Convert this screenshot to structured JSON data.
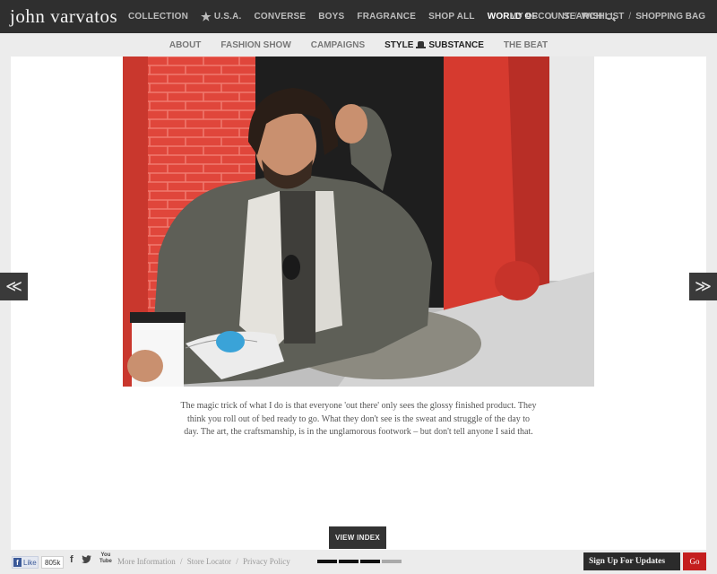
{
  "header": {
    "brand": "john varvatos",
    "nav": [
      {
        "label": "COLLECTION"
      },
      {
        "label": "U.S.A.",
        "icon": "star-icon"
      },
      {
        "label": "CONVERSE"
      },
      {
        "label": "BOYS"
      },
      {
        "label": "FRAGRANCE"
      },
      {
        "label": "SHOP ALL"
      },
      {
        "label": "WORLD OF",
        "active": true
      }
    ],
    "nav_separator": "/",
    "search_label": "SEARCH",
    "account": {
      "my_account": "MY ACCOUNT",
      "wishlist": "WISHLIST",
      "shopping_bag": "SHOPPING BAG",
      "separator": "/"
    }
  },
  "subnav": {
    "items": [
      "ABOUT",
      "FASHION SHOW",
      "CAMPAIGNS"
    ],
    "style_label": "STYLE",
    "substance_label": "SUBSTANCE",
    "beat_label": "THE BEAT"
  },
  "slideshow": {
    "prev_icon": "double-chevron-left-icon",
    "next_icon": "double-chevron-right-icon",
    "prev_glyph": "≪",
    "next_glyph": "≫",
    "quote": "The magic trick of what I do is that everyone 'out there' only sees the glossy finished product. They think you roll out of bed ready to go. What they don't see is the sweat and struggle of the day to day. The art, the craftsmanship, is in the unglamorous footwork – but don't tell anyone I said that.",
    "view_index_label": "VIEW INDEX",
    "pager_total": 4,
    "pager_active": 3
  },
  "footer": {
    "fb_like_label": "Like",
    "fb_count": "805k",
    "facebook_glyph": "f",
    "twitter_glyph": "🐦",
    "youtube_top": "You",
    "youtube_bottom": "Tube",
    "links": [
      "More Information",
      "Store Locator",
      "Privacy Policy"
    ],
    "links_separator": "/",
    "signup_label": "Sign Up For Updates",
    "go_label": "Go"
  },
  "colors": {
    "topbar": "#2f2f2f",
    "wall_red": "#d63a2f",
    "go_button": "#c41e1e"
  }
}
